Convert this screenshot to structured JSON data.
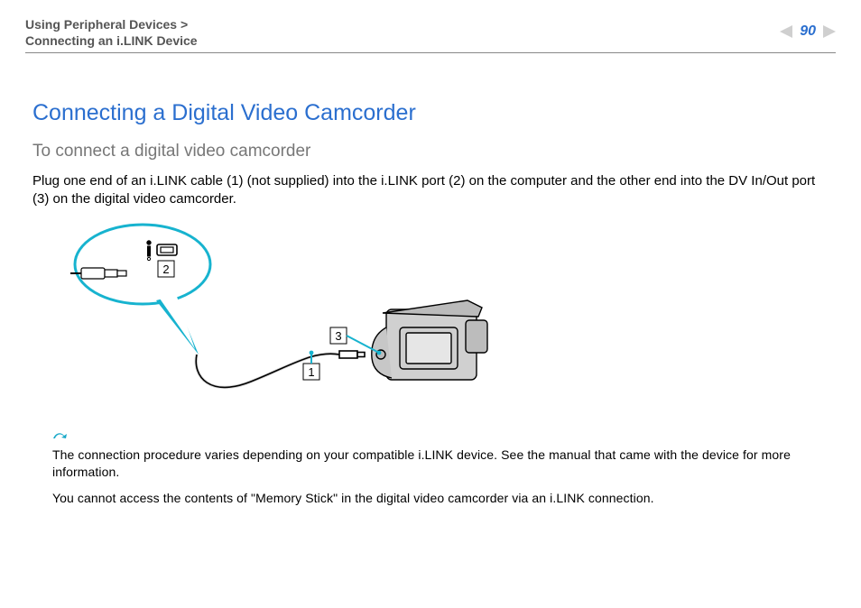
{
  "header": {
    "breadcrumb_top": "Using Peripheral Devices",
    "breadcrumb_sep": ">",
    "breadcrumb_bottom": "Connecting an i.LINK Device",
    "page_number": "90"
  },
  "title": "Connecting a Digital Video Camcorder",
  "subtitle": "To connect a digital video camcorder",
  "body_text": "Plug one end of an i.LINK cable (1) (not supplied) into the i.LINK port (2) on the computer and the other end into the DV In/Out port (3) on the digital video camcorder.",
  "diagram": {
    "label_1": "1",
    "label_2": "2",
    "label_3": "3"
  },
  "notes": {
    "line1": "The connection procedure varies depending on your compatible i.LINK device. See the manual that came with the device for more information.",
    "line2": "You cannot access the contents of \"Memory Stick\" in the digital video camcorder via an i.LINK connection."
  }
}
